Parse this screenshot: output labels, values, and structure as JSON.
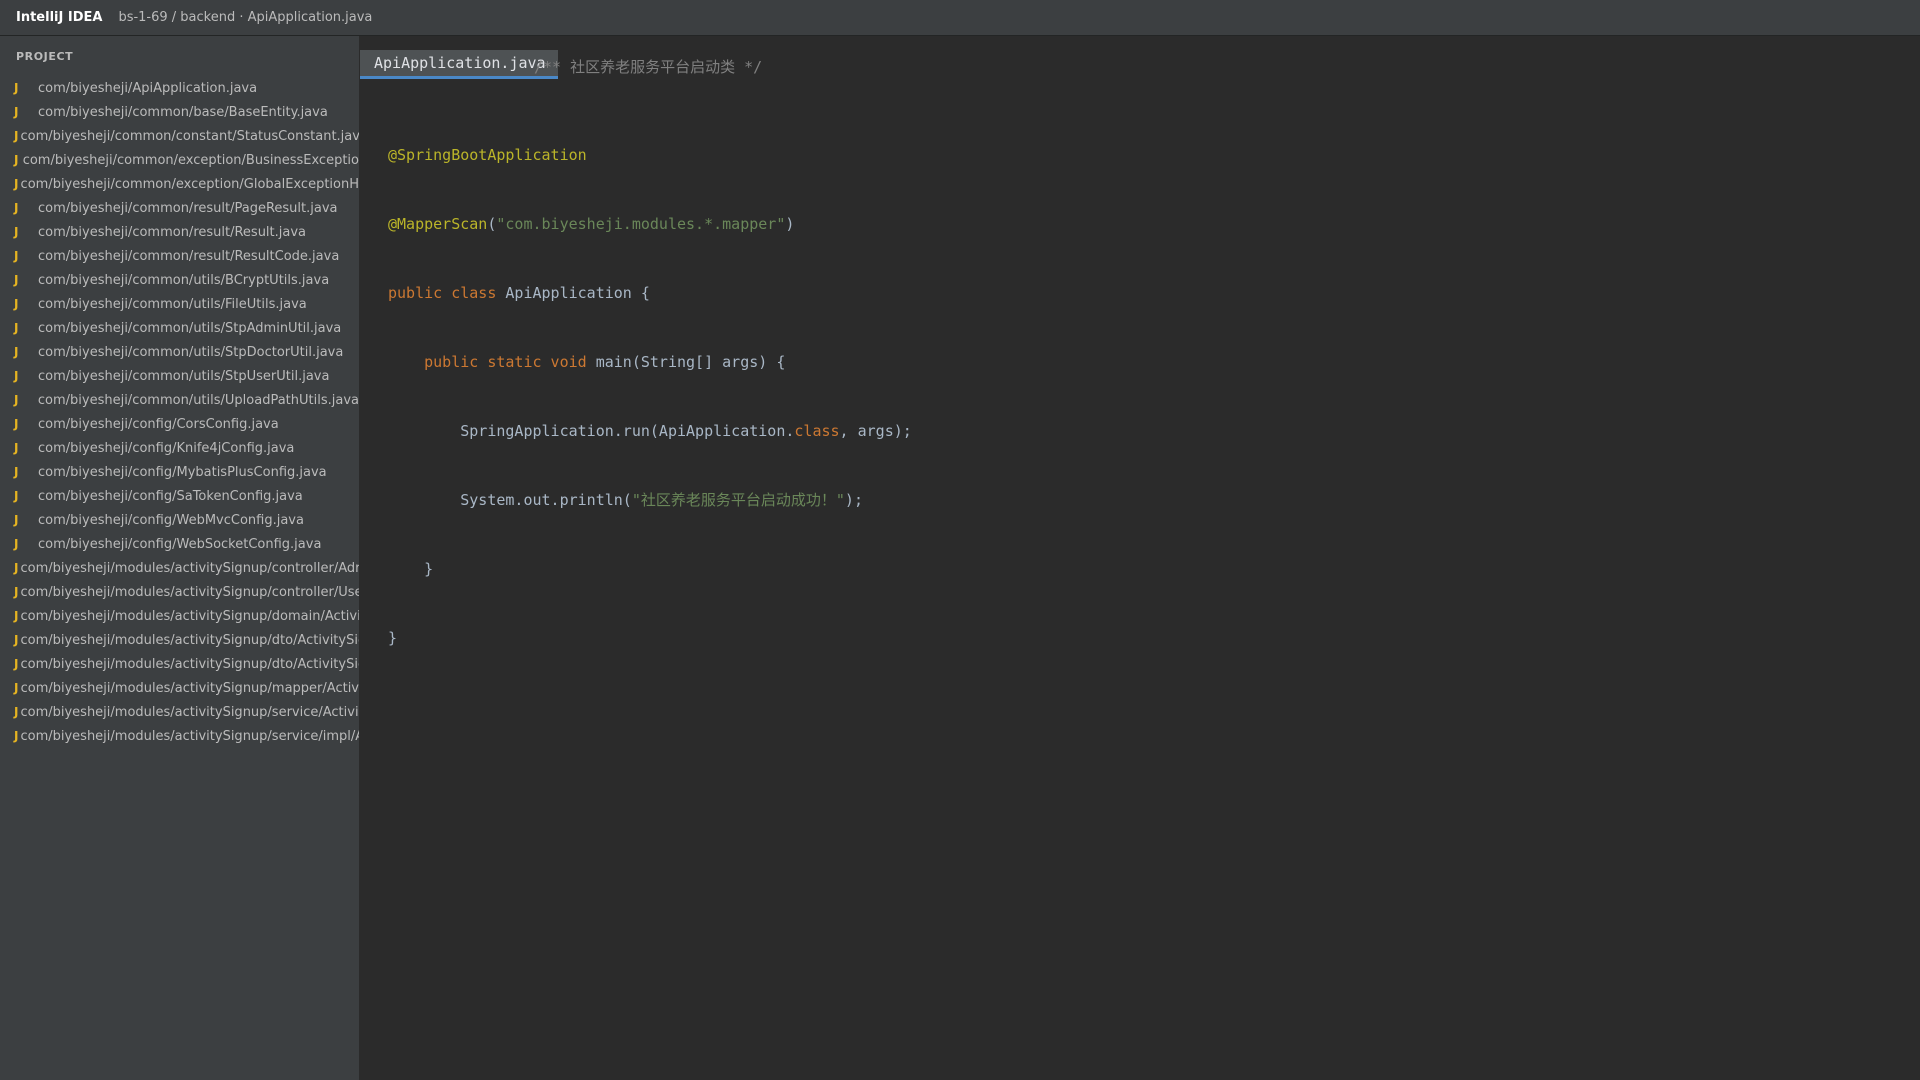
{
  "titlebar": {
    "app_name": "IntelliJ IDEA",
    "breadcrumb": "bs-1-69 / backend · ApiApplication.java"
  },
  "sidebar": {
    "header": "PROJECT",
    "file_icon_glyph": "J",
    "files": [
      "com/biyesheji/ApiApplication.java",
      "com/biyesheji/common/base/BaseEntity.java",
      "com/biyesheji/common/constant/StatusConstant.jav",
      "com/biyesheji/common/exception/BusinessExceptio",
      "com/biyesheji/common/exception/GlobalExceptionH",
      "com/biyesheji/common/result/PageResult.java",
      "com/biyesheji/common/result/Result.java",
      "com/biyesheji/common/result/ResultCode.java",
      "com/biyesheji/common/utils/BCryptUtils.java",
      "com/biyesheji/common/utils/FileUtils.java",
      "com/biyesheji/common/utils/StpAdminUtil.java",
      "com/biyesheji/common/utils/StpDoctorUtil.java",
      "com/biyesheji/common/utils/StpUserUtil.java",
      "com/biyesheji/common/utils/UploadPathUtils.java",
      "com/biyesheji/config/CorsConfig.java",
      "com/biyesheji/config/Knife4jConfig.java",
      "com/biyesheji/config/MybatisPlusConfig.java",
      "com/biyesheji/config/SaTokenConfig.java",
      "com/biyesheji/config/WebMvcConfig.java",
      "com/biyesheji/config/WebSocketConfig.java",
      "com/biyesheji/modules/activitySignup/controller/Adr",
      "com/biyesheji/modules/activitySignup/controller/Use",
      "com/biyesheji/modules/activitySignup/domain/Activi",
      "com/biyesheji/modules/activitySignup/dto/ActivitySig",
      "com/biyesheji/modules/activitySignup/dto/ActivitySig",
      "com/biyesheji/modules/activitySignup/mapper/Activ",
      "com/biyesheji/modules/activitySignup/service/Activit",
      "com/biyesheji/modules/activitySignup/service/impl/A"
    ]
  },
  "editor": {
    "tab_label": "ApiApplication.java",
    "tab_overlay_comment": "/** 社区养老服务平台启动类 */",
    "code": {
      "line1": "@SpringBootApplication",
      "line2_ann": "@MapperScan",
      "line2_open": "(",
      "line2_str": "\"com.biyesheji.modules.*.mapper\"",
      "line2_close": ")",
      "line3_kw": "public class",
      "line3_rest": " ApiApplication {",
      "line4_indent": "    ",
      "line4_kw": "public static void",
      "line4_rest": " main(String[] args) {",
      "line5_indent": "        ",
      "line5_pre": "SpringApplication.run(ApiApplication.",
      "line5_kw": "class",
      "line5_post": ", args);",
      "line6_indent": "        ",
      "line6_pre": "System.out.println(",
      "line6_str": "\"社区养老服务平台启动成功！\"",
      "line6_post": ");",
      "line7": "    }",
      "line8": "}"
    }
  },
  "colors": {
    "titlebar_bg": "#3c3f41",
    "editor_bg": "#2b2b2b",
    "annotation": "#bbb529",
    "keyword": "#cc7832",
    "string": "#6a8759",
    "comment": "#808080",
    "java_icon": "#e6b422",
    "tab_underline": "#4a88c7"
  }
}
